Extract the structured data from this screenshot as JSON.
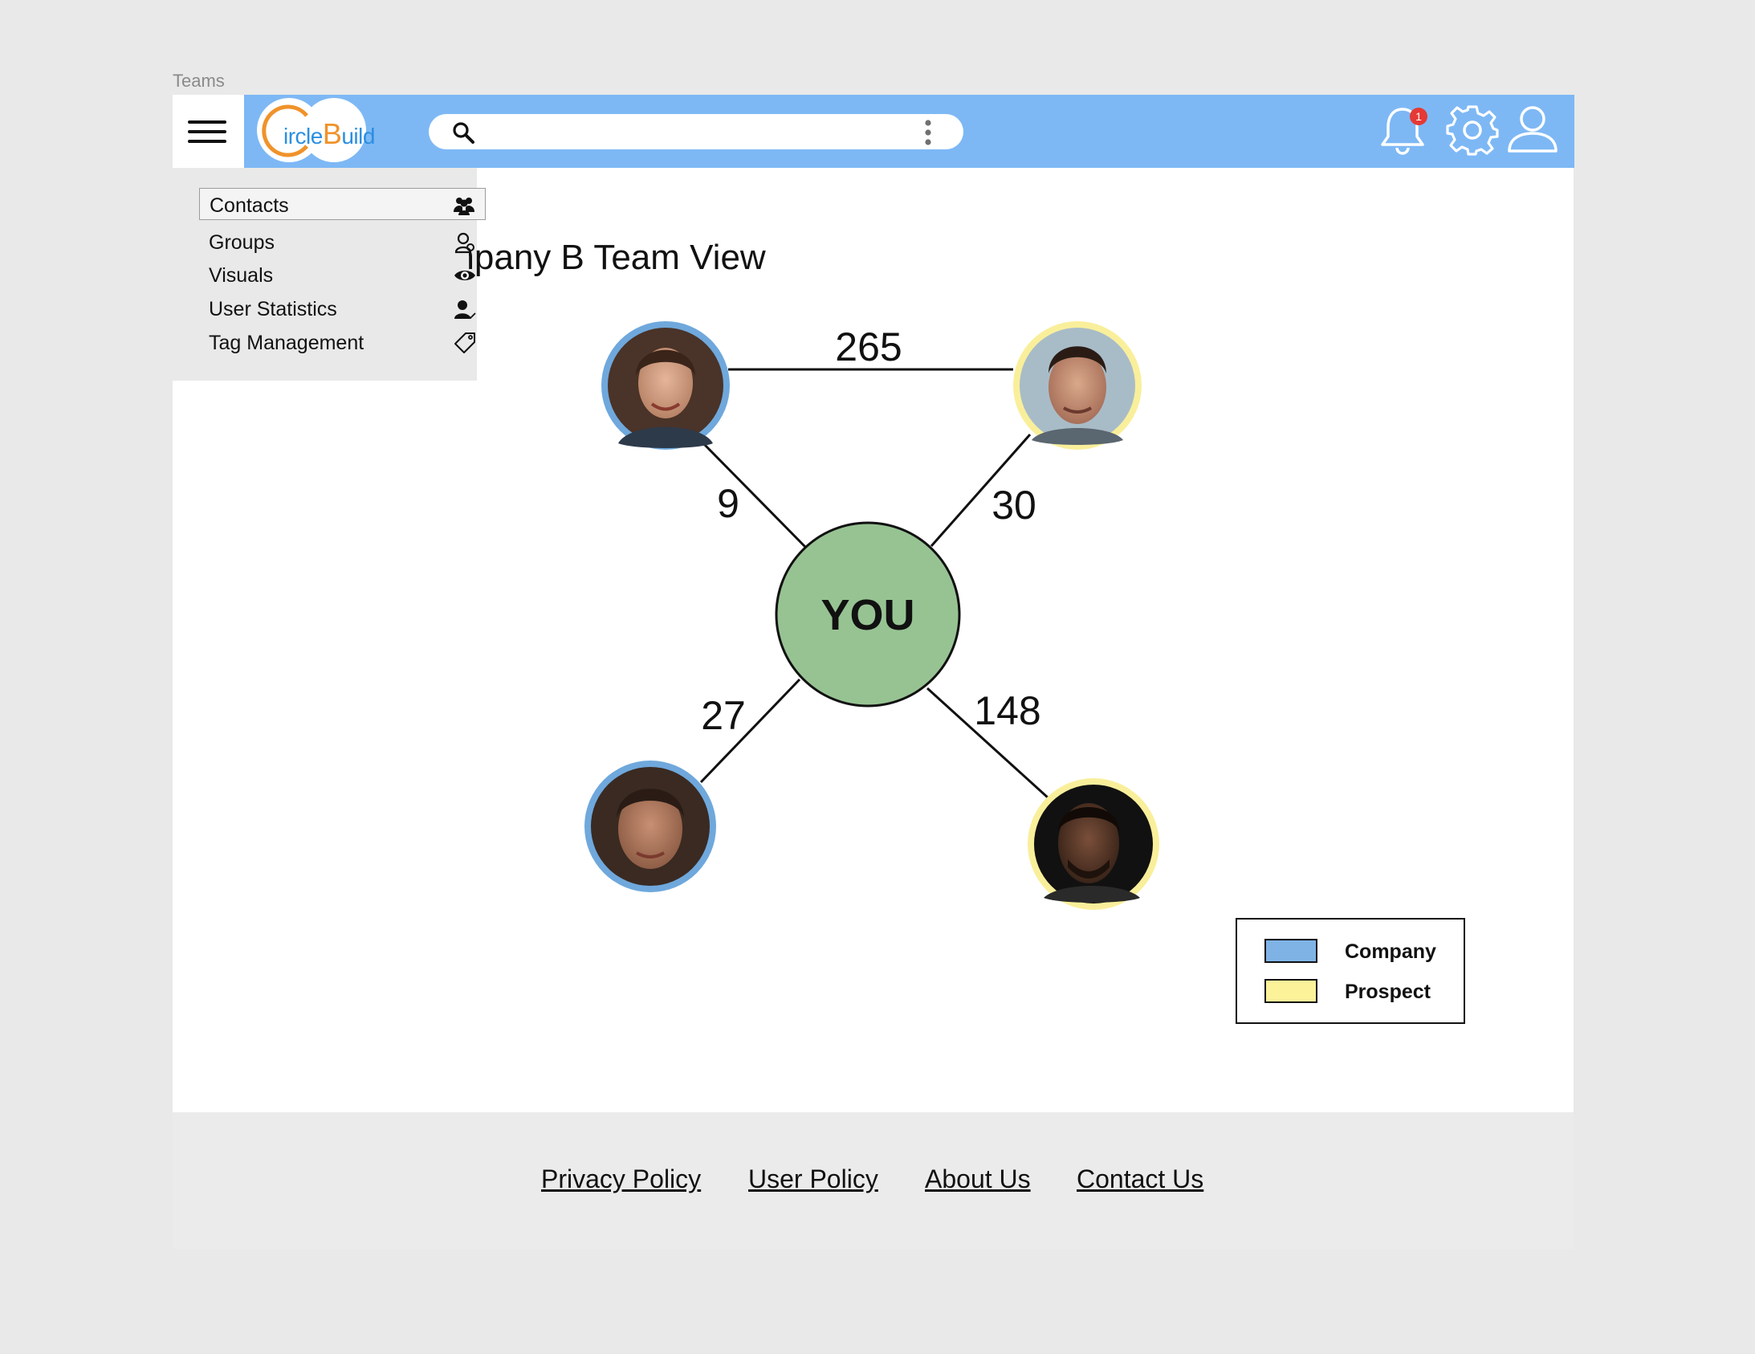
{
  "page": {
    "label": "Teams"
  },
  "header": {
    "logo": {
      "part1": "ircle",
      "part2": "B",
      "part3": "uild"
    },
    "search": {
      "placeholder": "",
      "value": ""
    },
    "notifications": {
      "count": "1"
    },
    "icons": [
      "menu-icon",
      "search-icon",
      "more-vertical-icon",
      "bell-icon",
      "gear-icon",
      "user-icon"
    ]
  },
  "sidebar": {
    "items": [
      {
        "label": "Contacts",
        "icon": "contacts-icon",
        "active": true
      },
      {
        "label": "Groups",
        "icon": "groups-icon",
        "active": false
      },
      {
        "label": "Visuals",
        "icon": "eye-icon",
        "active": false
      },
      {
        "label": "User Statistics",
        "icon": "user-statistics-icon",
        "active": false
      },
      {
        "label": "Tag Management",
        "icon": "tag-icon",
        "active": false
      }
    ]
  },
  "main": {
    "title": "Company B Team View",
    "center_node": {
      "label": "YOU",
      "color": "#97c393"
    },
    "people": [
      {
        "id": "top-left",
        "type": "Company"
      },
      {
        "id": "top-right",
        "type": "Prospect"
      },
      {
        "id": "bottom-left",
        "type": "Company"
      },
      {
        "id": "bottom-right",
        "type": "Prospect"
      }
    ],
    "edges": [
      {
        "from": "top-left",
        "to": "top-right",
        "value": "265"
      },
      {
        "from": "top-left",
        "to": "you",
        "value": "9"
      },
      {
        "from": "top-right",
        "to": "you",
        "value": "30"
      },
      {
        "from": "bottom-left",
        "to": "you",
        "value": "27"
      },
      {
        "from": "bottom-right",
        "to": "you",
        "value": "148"
      }
    ],
    "legend": [
      {
        "label": "Company",
        "color": "#7fb3e6"
      },
      {
        "label": "Prospect",
        "color": "#fbf29a"
      }
    ]
  },
  "footer": {
    "links": [
      "Privacy Policy",
      "User Policy",
      "About Us",
      "Contact Us"
    ]
  },
  "colors": {
    "topbar": "#7db8f5",
    "company_ring": "#6fa8dc",
    "prospect_ring": "#f9ef9b",
    "you_node": "#97c393",
    "badge": "#e53935"
  }
}
